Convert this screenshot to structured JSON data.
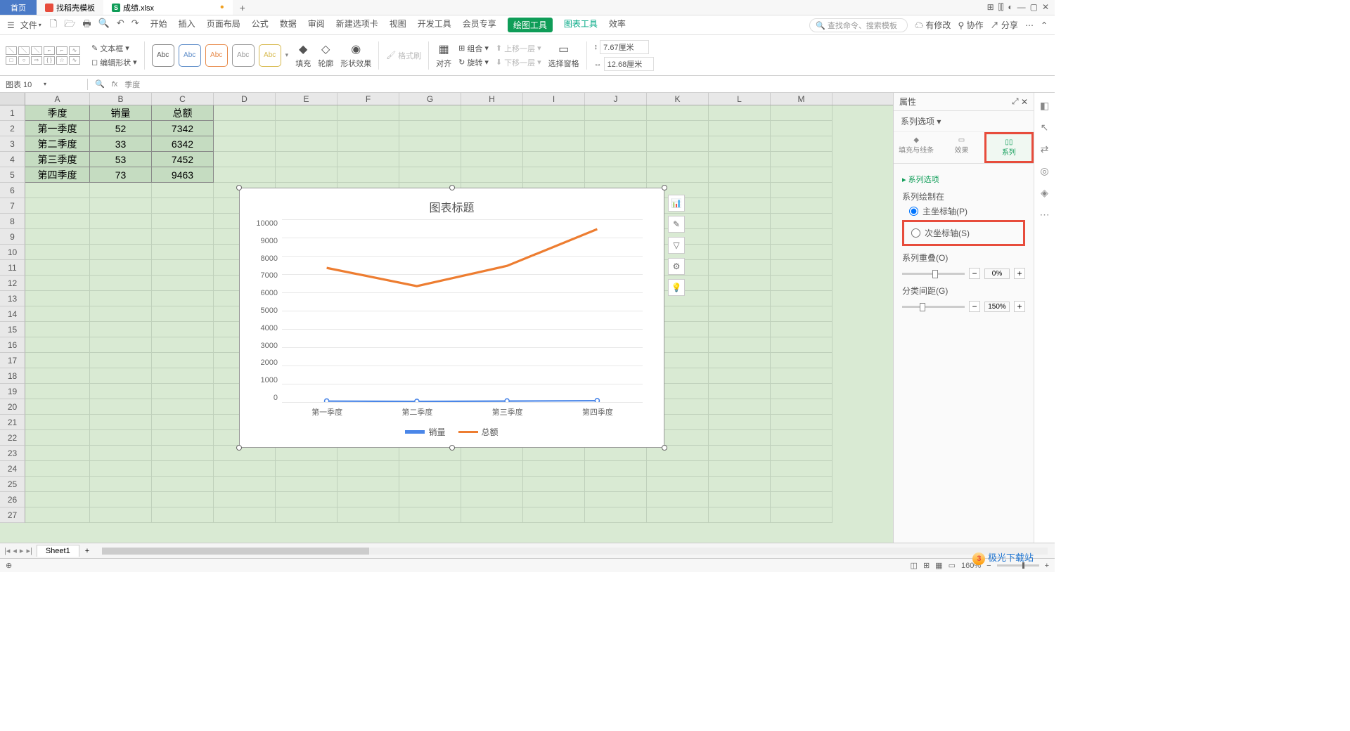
{
  "titlebar": {
    "home": "首页",
    "tab_template": "找稻壳模板",
    "tab_file": "成绩.xlsx",
    "plus": "+"
  },
  "menu": {
    "file": "文件",
    "tabs": [
      "开始",
      "插入",
      "页面布局",
      "公式",
      "数据",
      "审阅",
      "新建选项卡",
      "视图",
      "开发工具",
      "会员专享"
    ],
    "drawtool": "绘图工具",
    "charttool": "图表工具",
    "efficiency": "效率",
    "search_ph": "查找命令、搜索模板",
    "cloud": "有修改",
    "coop": "协作",
    "share": "分享"
  },
  "ribbon": {
    "textbox": "文本框",
    "editshape": "编辑形状",
    "fill": "填充",
    "outline": "轮廓",
    "effect": "形状效果",
    "align": "对齐",
    "rotate": "旋转",
    "group": "组合",
    "up": "上移一层",
    "down": "下移一层",
    "selpane": "选择窗格",
    "fmtpaint": "格式刷",
    "w": "7.67厘米",
    "h": "12.68厘米"
  },
  "formula": {
    "name": "图表 10",
    "fx_val": "季度"
  },
  "cols": [
    "A",
    "B",
    "C",
    "D",
    "E",
    "F",
    "G",
    "H",
    "I",
    "J",
    "K",
    "L",
    "M"
  ],
  "rows": [
    "1",
    "2",
    "3",
    "4",
    "5",
    "6",
    "7",
    "8",
    "9",
    "10",
    "11",
    "12",
    "13",
    "14",
    "15",
    "16",
    "17",
    "18",
    "19",
    "20",
    "21",
    "22",
    "23",
    "24",
    "25",
    "26",
    "27"
  ],
  "table": {
    "h": [
      "季度",
      "销量",
      "总额"
    ],
    "r": [
      [
        "第一季度",
        "52",
        "7342"
      ],
      [
        "第二季度",
        "33",
        "6342"
      ],
      [
        "第三季度",
        "53",
        "7452"
      ],
      [
        "第四季度",
        "73",
        "9463"
      ]
    ]
  },
  "chart_data": {
    "type": "line",
    "title": "图表标题",
    "categories": [
      "第一季度",
      "第二季度",
      "第三季度",
      "第四季度"
    ],
    "series": [
      {
        "name": "销量",
        "values": [
          52,
          33,
          53,
          73
        ]
      },
      {
        "name": "总额",
        "values": [
          7342,
          6342,
          7452,
          9463
        ]
      }
    ],
    "ylabel": "",
    "xlabel": "",
    "yticks": [
      0,
      1000,
      2000,
      3000,
      4000,
      5000,
      6000,
      7000,
      8000,
      9000,
      10000
    ],
    "ylim": [
      0,
      10000
    ]
  },
  "panel": {
    "title": "属性",
    "dropdown": "系列选项",
    "tabs": [
      "填充与线条",
      "效果",
      "系列"
    ],
    "sec": "系列选项",
    "plot_on": "系列绘制在",
    "primary": "主坐标轴(P)",
    "secondary": "次坐标轴(S)",
    "overlap": "系列重叠(O)",
    "overlap_val": "0%",
    "gap": "分类间距(G)",
    "gap_val": "150%"
  },
  "sheet_tab": "Sheet1",
  "status": {
    "zoom": "160%"
  }
}
